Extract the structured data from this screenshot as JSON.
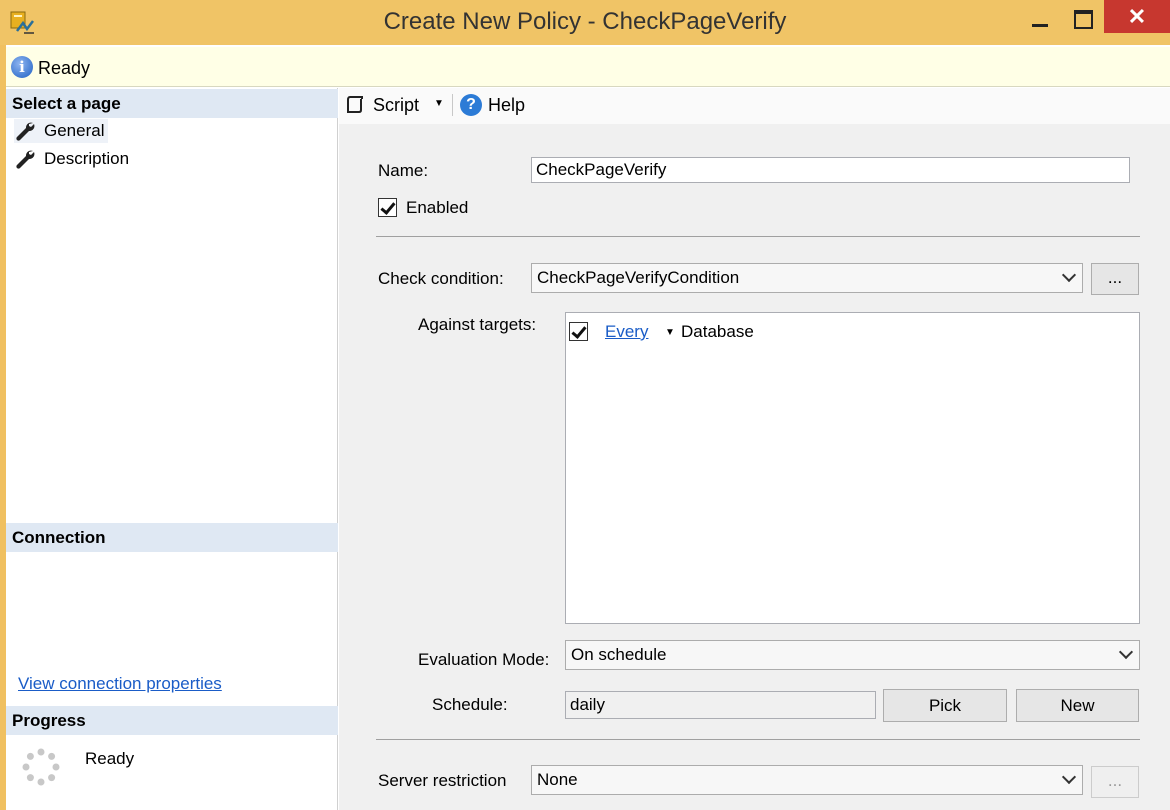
{
  "window": {
    "title": "Create New Policy - CheckPageVerify",
    "close_glyph": "✕"
  },
  "status": {
    "text": "Ready"
  },
  "left_panel": {
    "select_page_header": "Select a page",
    "pages": [
      {
        "label": "General",
        "icon": "wrench-icon",
        "selected": true
      },
      {
        "label": "Description",
        "icon": "wrench-icon",
        "selected": false
      }
    ],
    "connection_header": "Connection",
    "view_connection_link": "View connection properties",
    "progress_header": "Progress",
    "progress_text": "Ready"
  },
  "toolbar": {
    "script_label": "Script",
    "dropdown_glyph": "▼",
    "help_label": "Help",
    "help_glyph": "?"
  },
  "form": {
    "name_label": "Name:",
    "name_value": "CheckPageVerify",
    "enabled_label": "Enabled",
    "enabled_checked": true,
    "check_condition_label": "Check condition:",
    "check_condition_value": "CheckPageVerifyCondition",
    "ellipsis": "...",
    "against_targets_label": "Against targets:",
    "targets": [
      {
        "checked": true,
        "quantifier": "Every",
        "object": "Database"
      }
    ],
    "evaluation_mode_label": "Evaluation Mode:",
    "evaluation_mode_value": "On schedule",
    "schedule_label": "Schedule:",
    "schedule_value": "daily",
    "pick_button": "Pick",
    "new_button": "New",
    "server_restriction_label": "Server restriction",
    "server_restriction_value": "None"
  },
  "colors": {
    "titlebar": "#f0c466",
    "close_button": "#c7372f",
    "status_bar": "#ffffe6",
    "section_header": "#dfe8f3",
    "link": "#1a5cc7"
  }
}
